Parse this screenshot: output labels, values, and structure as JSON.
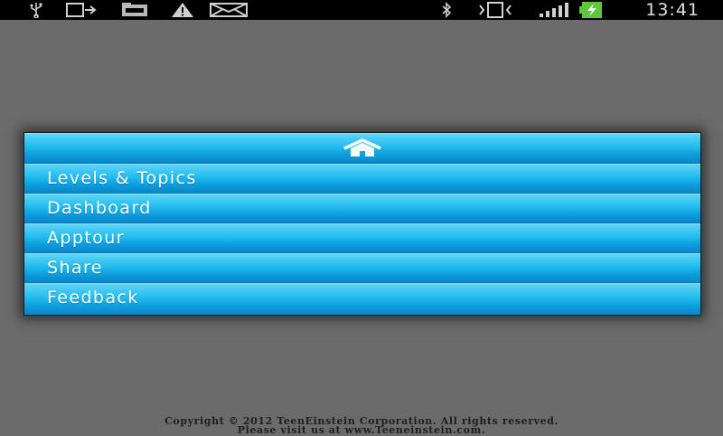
{
  "status_bar": {
    "time": "13:41",
    "icons": [
      "usb-icon",
      "phone-out-icon",
      "sd-card-icon",
      "warning-icon",
      "email-icon",
      "bluetooth-icon",
      "vibrate-icon",
      "signal-icon",
      "battery-charging-icon"
    ]
  },
  "menu": {
    "home_icon": "home-icon",
    "items": [
      {
        "label": "Levels & Topics"
      },
      {
        "label": "Dashboard"
      },
      {
        "label": "Apptour"
      },
      {
        "label": "Share"
      },
      {
        "label": "Feedback"
      }
    ]
  },
  "footer": {
    "line1": "Copyright © 2012 TeenEinstein Corporation. All rights reserved.",
    "line2": "Please visit us at www.Teeneinstein.com."
  },
  "colors": {
    "background": "#6b6b6b",
    "menu_accent": "#22bbee",
    "status_bar": "#000000"
  }
}
